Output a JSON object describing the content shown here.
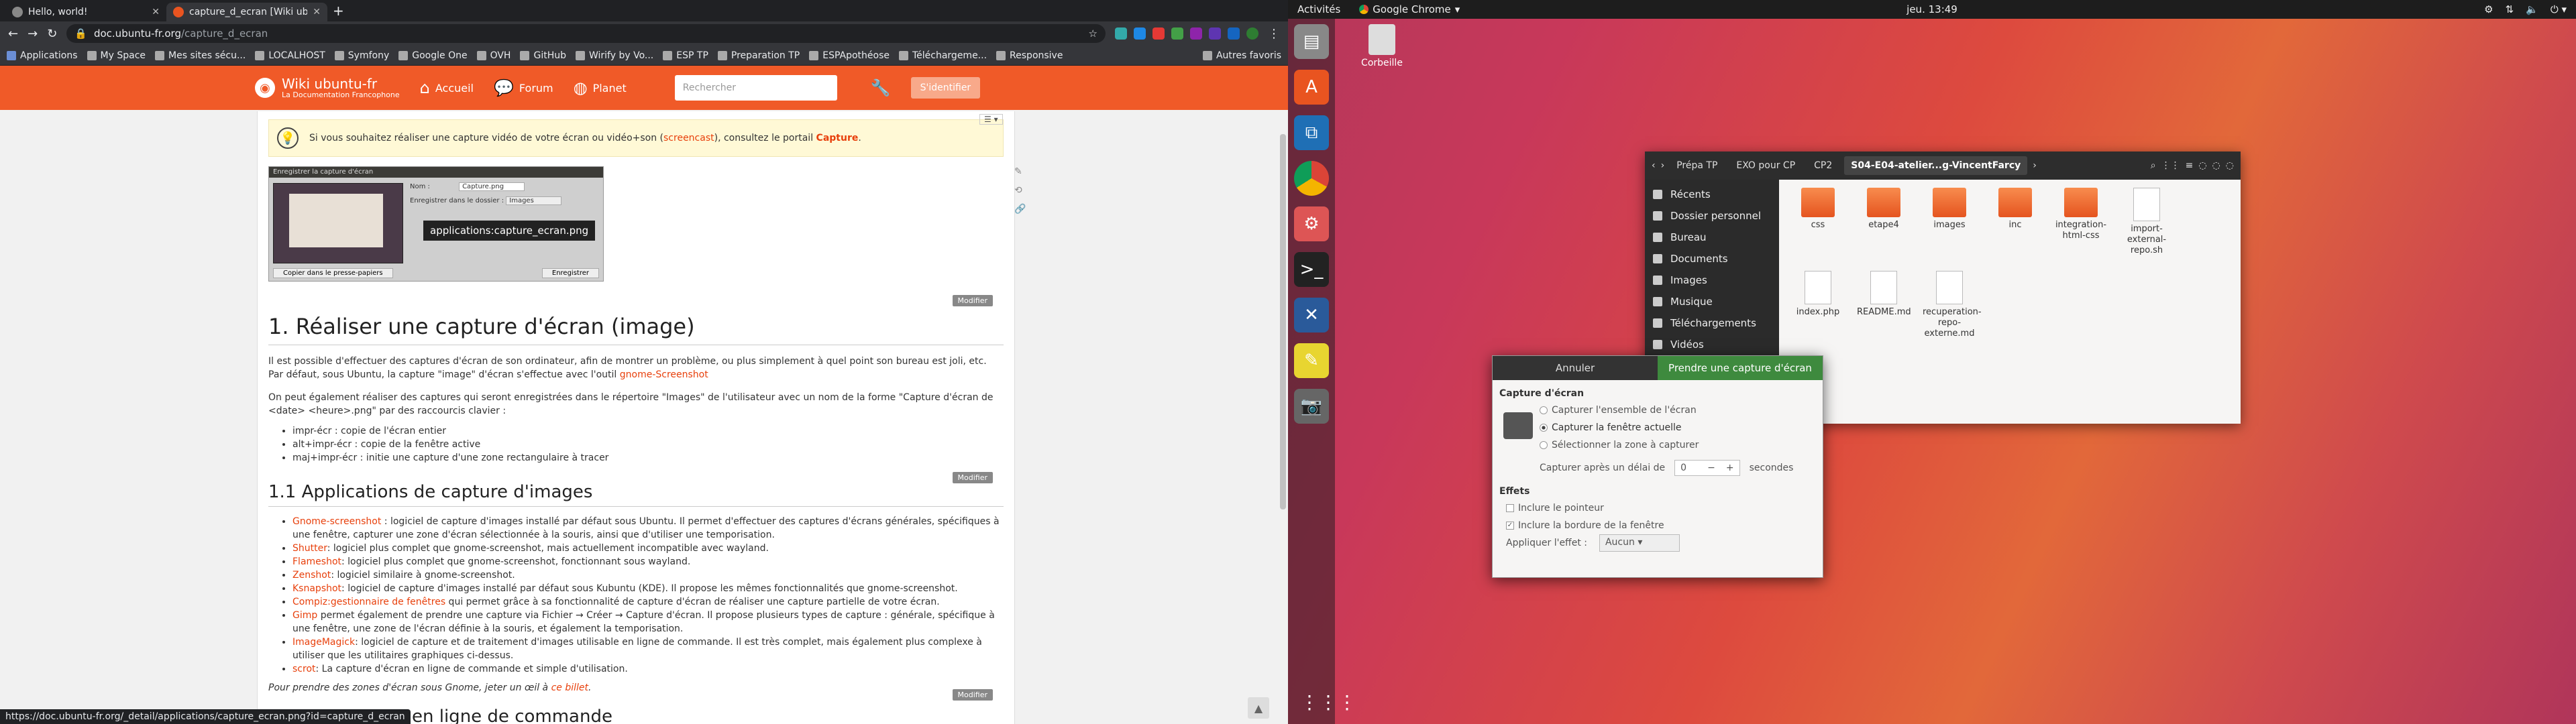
{
  "browser": {
    "tabs": [
      {
        "label": "Hello, world!",
        "active": false
      },
      {
        "label": "capture_d_ecran [Wiki ub…",
        "active": true
      }
    ],
    "url_host": "doc.ubuntu-fr.org",
    "url_path": "/capture_d_ecran",
    "bookmarks": [
      "Applications",
      "My Space",
      "Mes sites sécu...",
      "LOCALHOST",
      "Symfony",
      "Google One",
      "OVH",
      "GitHub",
      "Wirify by Vo...",
      "ESP TP",
      "Preparation TP",
      "ESPApothéose",
      "Téléchargeme...",
      "Responsive",
      "Autres favoris"
    ],
    "status_url": "https://doc.ubuntu-fr.org/_detail/applications/capture_ecran.png?id=capture_d_ecran"
  },
  "wiki": {
    "logo_title": "Wiki ubuntu-fr",
    "logo_sub": "La Documentation Francophone",
    "nav": [
      {
        "label": "Accueil"
      },
      {
        "label": "Forum"
      },
      {
        "label": "Planet"
      }
    ],
    "search_placeholder": "Rechercher",
    "login": "S'identifier",
    "note": "Si vous souhaitez réaliser une capture vidéo de votre écran ou vidéo+son (",
    "note_link1": "screencast",
    "note_mid": "), consultez le portail ",
    "note_link2": "Capture",
    "note_end": ".",
    "image_tooltip": "applications:capture_ecran.png",
    "shot_title": "Enregistrer la capture d'écran",
    "shot_name_label": "Nom :",
    "shot_name_value": "Capture.png",
    "shot_folder_label": "Enregistrer dans le dossier :",
    "shot_folder_value": "Images",
    "shot_copy": "Copier dans le presse-papiers",
    "shot_save": "Enregistrer",
    "modify": "Modifier",
    "h1": "1. Réaliser une capture d'écran (image)",
    "p1": "Il est possible d'effectuer des captures d'écran de son ordinateur, afin de montrer un problème, ou plus simplement à quel point son bureau est joli, etc. Par défaut, sous Ubuntu, la capture \"image\" d'écran s'effectue avec l'outil",
    "p1_link": "gnome-Screenshot",
    "p2": "On peut également réaliser des captures qui seront enregistrées dans le répertoire \"Images\" de l'utilisateur avec un nom de la forme \"Capture d'écran de <date> <heure>.png\" par des raccourcis clavier :",
    "shortcuts": [
      "impr-écr : copie de l'écran entier",
      "alt+impr-écr : copie de la fenêtre active",
      "maj+impr-écr : initie une capture d'une zone rectangulaire à tracer"
    ],
    "h2": "1.1 Applications de capture d'images",
    "apps": [
      {
        "name": "Gnome-screenshot",
        "desc": " : logiciel de capture d'images installé par défaut sous Ubuntu. Il permet d'effectuer des captures d'écrans générales, spécifiques à une fenêtre, capturer une zone d'écran sélectionnée à la souris, ainsi que d'utiliser une temporisation."
      },
      {
        "name": "Shutter",
        "desc": ": logiciel plus complet que gnome-screenshot, mais actuellement incompatible avec wayland."
      },
      {
        "name": "Flameshot",
        "desc": ": logiciel plus complet que gnome-screenshot, fonctionnant sous wayland."
      },
      {
        "name": "Zenshot",
        "desc": ": logiciel similaire à gnome-screenshot."
      },
      {
        "name": "Ksnapshot",
        "desc": ": logiciel de capture d'images installé par défaut sous Kubuntu (KDE). Il propose les mêmes fonctionnalités que gnome-screenshot."
      },
      {
        "name": "Compiz:gestionnaire de fenêtres",
        "desc": " qui permet grâce à sa fonctionnalité de capture d'écran de réaliser une capture partielle de votre écran."
      },
      {
        "name": "Gimp",
        "desc": " permet également de prendre une capture via Fichier → Créer → Capture d'écran. Il propose plusieurs types de capture : générale, spécifique à une fenêtre, une zone de l'écran définie à la souris, et également la temporisation."
      },
      {
        "name": "ImageMagick",
        "desc": ": logiciel de capture et de traitement d'images utilisable en ligne de commande. Il est très complet, mais également plus complexe à utiliser que les utilitaires graphiques ci-dessus."
      },
      {
        "name": "scrot",
        "desc": ": La capture d'écran en ligne de commande et simple d'utilisation."
      }
    ],
    "italic_note": "Pour prendre des zones d'écran sous Gnome, jeter un œil à ",
    "italic_link": "ce billet",
    "italic_end": ".",
    "h1_cut": "en ligne de commande"
  },
  "ubuntu": {
    "activities": "Activités",
    "app_menu": "Google Chrome",
    "clock": "jeu. 13:49",
    "desktop_icon": "Corbeille",
    "files": {
      "breadcrumbs": [
        "Prépa TP",
        "EXO pour CP",
        "CP2",
        "S04-E04-atelier...g-VincentFarcy"
      ],
      "sidebar": [
        "Récents",
        "Dossier personnel",
        "Bureau",
        "Documents",
        "Images",
        "Musique",
        "Téléchargements",
        "Vidéos"
      ],
      "items": [
        {
          "name": "css",
          "kind": "folder"
        },
        {
          "name": "etape4",
          "kind": "folder"
        },
        {
          "name": "images",
          "kind": "folder"
        },
        {
          "name": "inc",
          "kind": "folder"
        },
        {
          "name": "integration-html-css",
          "kind": "folder"
        },
        {
          "name": "import-external-repo.sh",
          "kind": "file"
        },
        {
          "name": "index.php",
          "kind": "file"
        },
        {
          "name": "README.md",
          "kind": "file"
        },
        {
          "name": "recuperation-repo-externe.md",
          "kind": "file"
        }
      ]
    },
    "screenshot_dialog": {
      "cancel": "Annuler",
      "take": "Prendre une capture d'écran",
      "section1": "Capture d'écran",
      "opt1": "Capturer l'ensemble de l'écran",
      "opt2": "Capturer la fenêtre actuelle",
      "opt3": "Sélectionner la zone à capturer",
      "delay_label": "Capturer après un délai de",
      "delay_value": "0",
      "delay_unit": "secondes",
      "section2": "Effets",
      "eff1": "Inclure le pointeur",
      "eff2": "Inclure la bordure de la fenêtre",
      "effect_label": "Appliquer l'effet :",
      "effect_value": "Aucun"
    }
  }
}
